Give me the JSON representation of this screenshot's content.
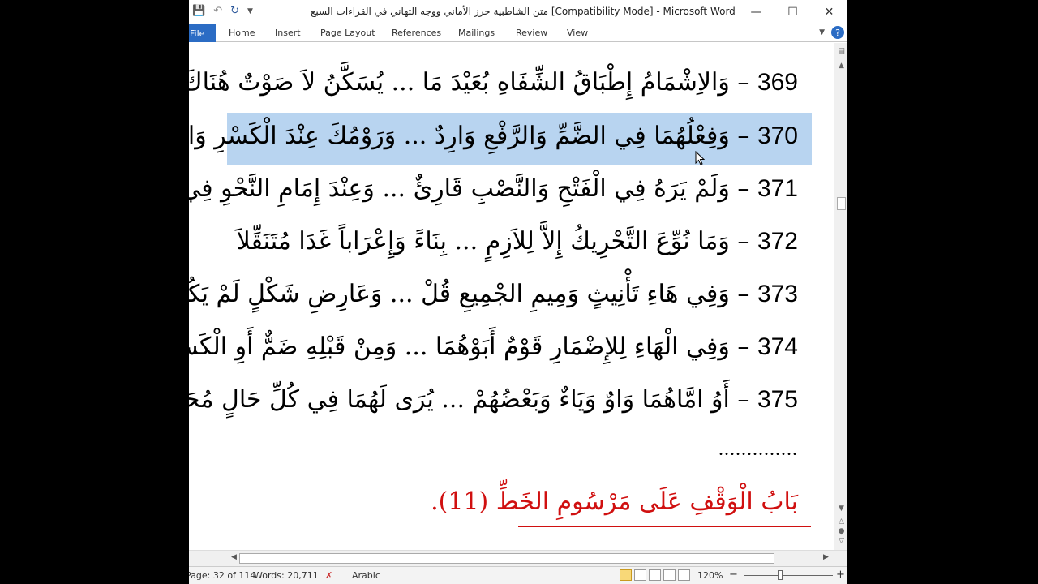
{
  "window": {
    "title": "متن الشاطبية حرز الأماني ووجه التهاني في القراءات السبع [Compatibility Mode] - Microsoft Word",
    "controls": {
      "minimize": "—",
      "maximize": "☐",
      "close": "✕"
    }
  },
  "qat": {
    "save_icon": "floppy-icon",
    "undo_icon": "undo-icon",
    "redo_icon": "redo-icon"
  },
  "ribbon": {
    "file": "File",
    "tabs": [
      "Home",
      "Insert",
      "Page Layout",
      "References",
      "Mailings",
      "Review",
      "View"
    ]
  },
  "document": {
    "verses": [
      {
        "num": "369",
        "text": "– وَالاِشْمَامُ إِطْبَاقُ الشِّفَاهِ بُعَيْدَ مَا ... يُسَكَّنُ لاَ صَوْتٌ هُنَاكَ فَيَصْحَلاَ"
      },
      {
        "num": "370",
        "text": "– وَفِعْلُهُمَا فِي الضَّمِّ وَالرَّفْعِ وَارِدٌ ... وَرَوْمُكَ عِنْدَ الْكَسْرِ وَالجَرِّ وُصِّلاَ"
      },
      {
        "num": "371",
        "text": "– وَلَمْ يَرَهُ فِي الْفَتْحِ وَالنَّصْبِ قَارِئٌ ... وَعِنْدَ إِمَامِ النَّحْوِ فِي الْكُلِّ أُعْمِلاَ"
      },
      {
        "num": "372",
        "text": "– وَمَا نُوِّعَ التَّحْرِيكُ إِلاَّ لِلاَزِمٍ ... بِنَاءً وَإِعْرَاباً غَدَا مُتَنَقِّلاَ"
      },
      {
        "num": "373",
        "text": "– وَفِي هَاءِ تَأْنِيثٍ وَمِيمِ الجْمِيعِ قُلْ ... وَعَارِضِ شَكْلٍ لَمْ يَكُونَا لِيَدْخُلاَ"
      },
      {
        "num": "374",
        "text": "– وَفِي الْهَاءِ لِلإِضْمَارِ قَوْمٌ أَبَوْهُمَا ... وَمِنْ قَبْلِهِ ضَمٌّ أَوِ الْكَسْرُ مُثِّلاَ"
      },
      {
        "num": "375",
        "text": "– أَوُ امَّاهُمَا وَاوٌ وَيَاءٌ وَبَعْضُهُمْ ... يُرَى لَهُمَا فِي كُلِّ حَالٍ مُحَلِّلاَ"
      }
    ],
    "dots": "..............",
    "heading": "بَابُ الْوَقْفِ عَلَى مَرْسُومِ الخَطِّ (11).",
    "highlight_color": "#b8d4f0",
    "heading_color": "#d01010"
  },
  "status": {
    "page": "Page: 32 of 114",
    "words": "Words: 20,711",
    "language": "Arabic",
    "zoom": "120%",
    "zoom_minus": "−",
    "zoom_plus": "+"
  }
}
